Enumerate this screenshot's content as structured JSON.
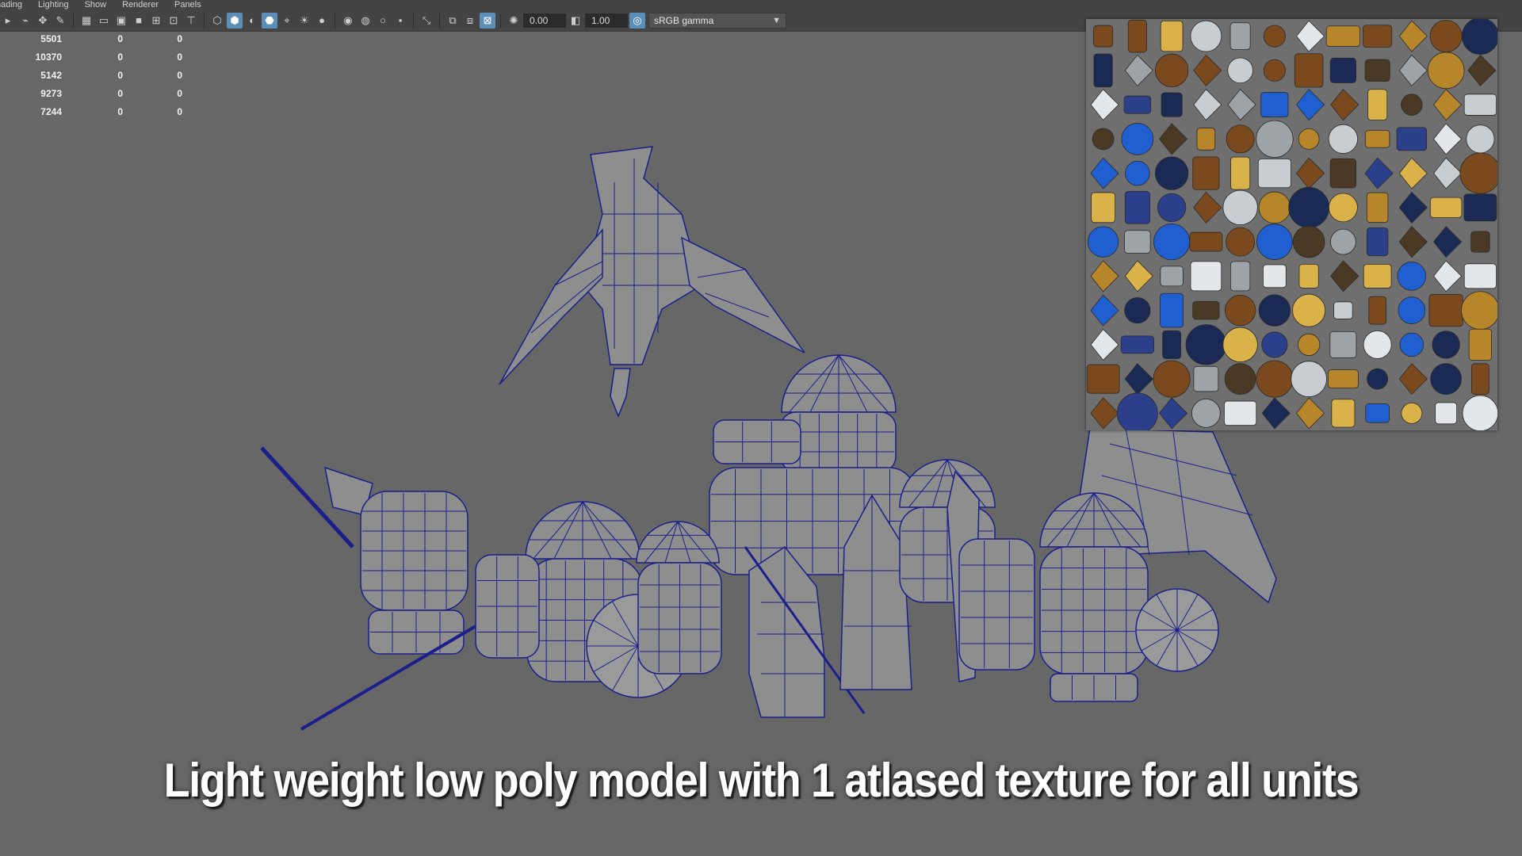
{
  "menu": [
    "hading",
    "Lighting",
    "Show",
    "Renderer",
    "Panels"
  ],
  "toolbar": {
    "exposure": "0.00",
    "gamma": "1.00",
    "color_space": "sRGB gamma",
    "icons": [
      "select-icon",
      "lasso-icon",
      "paint-select-icon",
      "brush-icon",
      "grid-icon",
      "film-gate-icon",
      "resolution-gate-icon",
      "gate-mask-icon",
      "field-chart-icon",
      "safe-action-icon",
      "safe-title-icon",
      "wireframe-icon",
      "smooth-shade-icon",
      "default-material-icon",
      "wireframe-on-shaded-icon",
      "xray-icon",
      "lights-icon",
      "shadows-icon",
      "ambient-occlusion-icon",
      "motion-blur-icon",
      "anti-alias-icon",
      "isolate-select-icon",
      "xray-joints-icon",
      "xray-active-icon",
      "camera-attr-icon",
      "exposure-icon",
      "gamma-icon",
      "color-management-icon",
      "dropdown-arrow-icon"
    ]
  },
  "hud": {
    "rows": [
      [
        "5501",
        "0",
        "0"
      ],
      [
        "10370",
        "0",
        "0"
      ],
      [
        "5142",
        "0",
        "0"
      ],
      [
        "9273",
        "0",
        "0"
      ],
      [
        "7244",
        "0",
        "0"
      ]
    ]
  },
  "colors": {
    "viewport_bg": "#676767",
    "wireframe": "#1c1f8a",
    "mesh_fill": "#8e8e8e",
    "toolbar_active": "#5b8fb9",
    "atlas_blue": "#1f5fd0",
    "atlas_gold": "#b8862a",
    "atlas_steel": "#9ea3a8"
  },
  "caption": "Light weight low poly model with 1 atlased texture for all units"
}
